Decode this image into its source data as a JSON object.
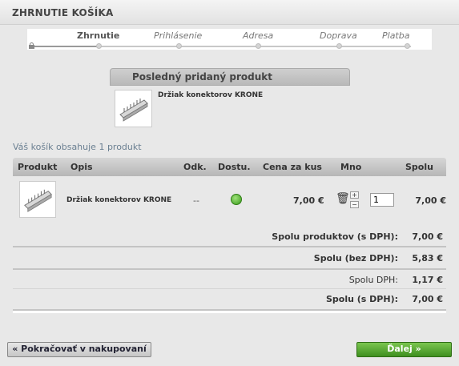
{
  "header": {
    "title": "ZHRNUTIE KOŠÍKA"
  },
  "steps": [
    {
      "label": "Zhrnutie",
      "active": true
    },
    {
      "label": "Prihlásenie",
      "active": false
    },
    {
      "label": "Adresa",
      "active": false
    },
    {
      "label": "Doprava",
      "active": false
    },
    {
      "label": "Platba",
      "active": false
    }
  ],
  "last_added": {
    "heading": "Posledný pridaný produkt",
    "product_name": "Držiak konektorov KRONE"
  },
  "cart_info": "Váš košík obsahuje 1 produkt",
  "table": {
    "headers": {
      "product": "Produkt",
      "desc": "Opis",
      "ref": "Odk.",
      "avail": "Dostu.",
      "unit_price": "Cena za kus",
      "qty": "Mno",
      "total": "Spolu"
    },
    "rows": [
      {
        "name": "Držiak konektorov KRONE",
        "ref": "--",
        "availability_color": "#4caf2a",
        "unit_price": "7,00 €",
        "quantity": "1",
        "total": "7,00 €"
      }
    ]
  },
  "summary": {
    "products_incl_vat_label": "Spolu produktov (s DPH):",
    "products_incl_vat": "7,00 €",
    "total_excl_vat_label": "Spolu (bez DPH):",
    "total_excl_vat": "5,83 €",
    "vat_label": "Spolu DPH:",
    "vat": "1,17 €",
    "total_incl_vat_label": "Spolu (s DPH):",
    "total_incl_vat": "7,00 €"
  },
  "buttons": {
    "continue_shopping": "« Pokračovať v nakupovaní",
    "next": "Ďalej »"
  },
  "icons": {
    "lock": "lock-icon",
    "trash": "trash-icon",
    "plus": "plus-icon",
    "minus": "minus-icon",
    "availability": "availability-dot-icon"
  }
}
